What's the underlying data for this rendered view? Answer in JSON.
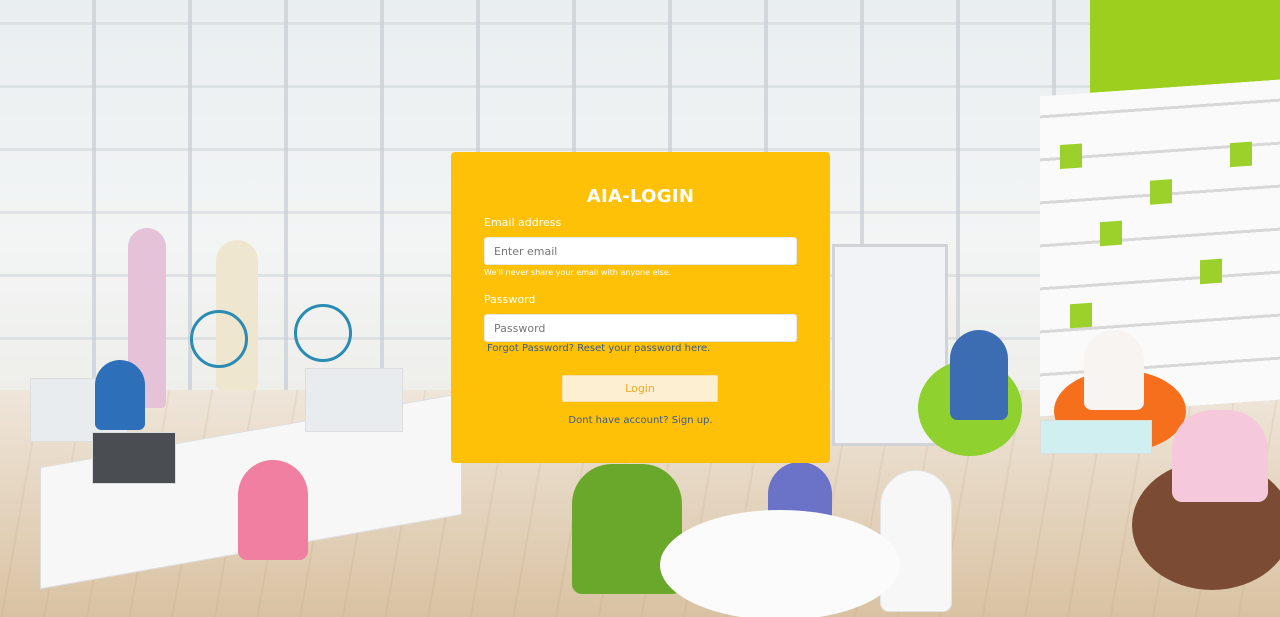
{
  "login": {
    "title": "AIA-LOGIN",
    "email_label": "Email address",
    "email_placeholder": "Enter email",
    "email_value": "",
    "email_help": "We'll never share your email with anyone else.",
    "password_label": "Password",
    "password_placeholder": "Password",
    "password_value": "",
    "forgot_link": "Forgot Password? Reset your password here.",
    "login_button": "Login",
    "signup_link": "Dont have account? Sign up."
  },
  "colors": {
    "card_background": "#ffc107",
    "title_text": "#ffffff",
    "link_text": "#3b5a8f",
    "button_text": "#f5a623"
  }
}
